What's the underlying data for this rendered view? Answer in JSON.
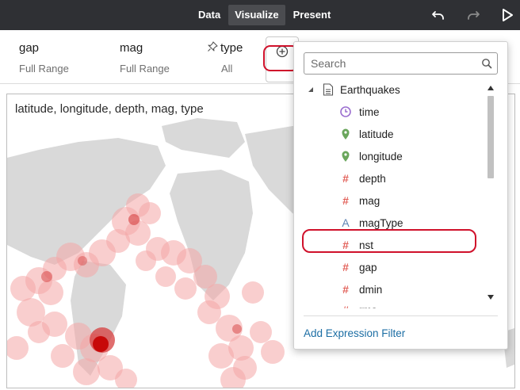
{
  "topbar": {
    "nav": [
      "Data",
      "Visualize",
      "Present"
    ],
    "active": "Visualize",
    "undo_icon": "undo-icon",
    "redo_icon": "redo-icon",
    "run_icon": "play-icon",
    "bg_color": "#2f3034"
  },
  "filters": [
    {
      "name": "gap",
      "value": "Full Range",
      "pinned": false
    },
    {
      "name": "mag",
      "value": "Full Range",
      "pinned": false
    },
    {
      "name": "type",
      "value": "All",
      "pinned": true
    }
  ],
  "add_filter_icon": "plus-circle-icon",
  "canvas": {
    "title": "latitude, longitude, depth, mag, type"
  },
  "dropdown": {
    "search_placeholder": "Search",
    "dataset": "Earthquakes",
    "columns": [
      {
        "label": "time",
        "icon": "clock-icon"
      },
      {
        "label": "latitude",
        "icon": "location-pin-icon"
      },
      {
        "label": "longitude",
        "icon": "location-pin-icon"
      },
      {
        "label": "depth",
        "icon": "hash-icon"
      },
      {
        "label": "mag",
        "icon": "hash-icon"
      },
      {
        "label": "magType",
        "icon": "text-attribute-icon"
      },
      {
        "label": "nst",
        "icon": "hash-icon"
      },
      {
        "label": "gap",
        "icon": "hash-icon"
      },
      {
        "label": "dmin",
        "icon": "hash-icon"
      },
      {
        "label": "rms",
        "icon": "hash-icon"
      }
    ],
    "highlighted_column": "nst",
    "add_expression_filter": "Add Expression Filter"
  },
  "colors": {
    "accent_link": "#1c6ea4",
    "highlight_ring": "#d0112b",
    "measure_icon": "#e2615a",
    "geo_icon": "#6aa65c",
    "time_icon": "#9b6fd0",
    "map_land": "#d9d9d9",
    "bubble": "#f4a6a6",
    "bubble_dark": "#c40000"
  }
}
